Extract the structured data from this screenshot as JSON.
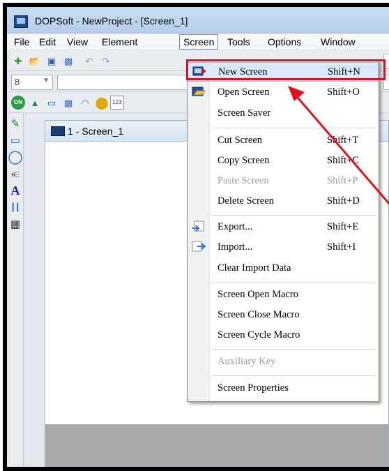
{
  "window": {
    "title": "DOPSoft - NewProject - [Screen_1]"
  },
  "menubar": {
    "items": [
      {
        "label": "File"
      },
      {
        "label": "Edit"
      },
      {
        "label": "View"
      },
      {
        "label": "Element"
      },
      {
        "label": "Screen",
        "active": true
      },
      {
        "label": "Tools"
      },
      {
        "label": "Options"
      },
      {
        "label": "Window"
      }
    ]
  },
  "toolbar": {
    "font_size_value": "8"
  },
  "document": {
    "tab_title": "1 - Screen_1"
  },
  "screen_menu": {
    "items": [
      {
        "label": "New Screen",
        "shortcut": "Shift+N",
        "icon": "new-screen-icon"
      },
      {
        "label": "Open Screen",
        "shortcut": "Shift+O",
        "icon": "open-screen-icon"
      },
      {
        "label": "Screen Saver",
        "shortcut": ""
      },
      {
        "label": "Cut Screen",
        "shortcut": "Shift+T"
      },
      {
        "label": "Copy Screen",
        "shortcut": "Shift+C"
      },
      {
        "label": "Paste Screen",
        "shortcut": "Shift+P",
        "disabled": true
      },
      {
        "label": "Delete Screen",
        "shortcut": "Shift+D"
      },
      {
        "label": "Export...",
        "shortcut": "Shift+E",
        "icon": "export-icon"
      },
      {
        "label": "Import...",
        "shortcut": "Shift+I",
        "icon": "import-icon"
      },
      {
        "label": "Clear Import Data",
        "shortcut": ""
      },
      {
        "label": "Screen Open Macro",
        "shortcut": ""
      },
      {
        "label": "Screen Close Macro",
        "shortcut": ""
      },
      {
        "label": "Screen Cycle Macro",
        "shortcut": ""
      },
      {
        "label": "Auxiliary Key",
        "shortcut": "",
        "disabled": true
      },
      {
        "label": "Screen Properties",
        "shortcut": ""
      }
    ]
  },
  "colors": {
    "highlight_border": "#e0111c",
    "arrow": "#e0111c"
  }
}
